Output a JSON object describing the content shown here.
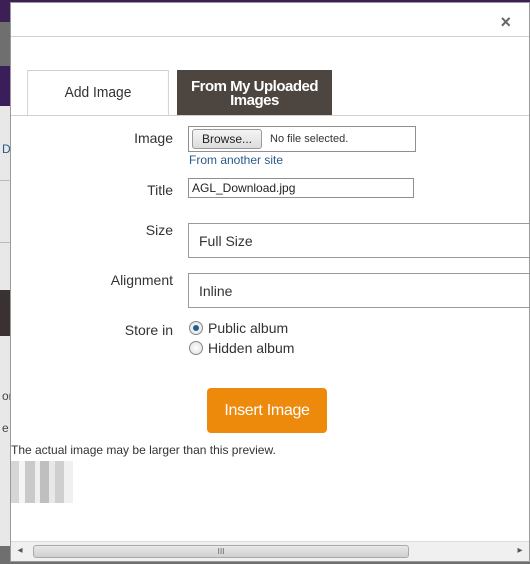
{
  "dialog": {
    "close_symbol": "×"
  },
  "tabs": [
    {
      "label": "Add Image",
      "active": true
    },
    {
      "label": "From My Uploaded Images",
      "active": false
    }
  ],
  "form": {
    "image_label": "Image",
    "browse_label": "Browse...",
    "no_file_text": "No file selected.",
    "another_site_link": "From another site",
    "title_label": "Title",
    "title_value": "AGL_Download.jpg",
    "size_label": "Size",
    "size_value": "Full Size",
    "alignment_label": "Alignment",
    "alignment_value": "Inline",
    "store_label": "Store in",
    "store_options": [
      {
        "label": "Public album",
        "checked": true
      },
      {
        "label": "Hidden album",
        "checked": false
      }
    ],
    "insert_button": "Insert Image",
    "preview_note": "The actual image may be larger than this preview."
  },
  "scrollbar": {
    "left_arrow": "◂",
    "right_arrow": "▸",
    "grip": "III"
  },
  "background_fragments": {
    "d": "D",
    "or": "or",
    "e": "e"
  },
  "colors": {
    "insert_button": "#ee8a0b",
    "inactive_tab": "#4c4540",
    "link": "#2a5a8a"
  }
}
